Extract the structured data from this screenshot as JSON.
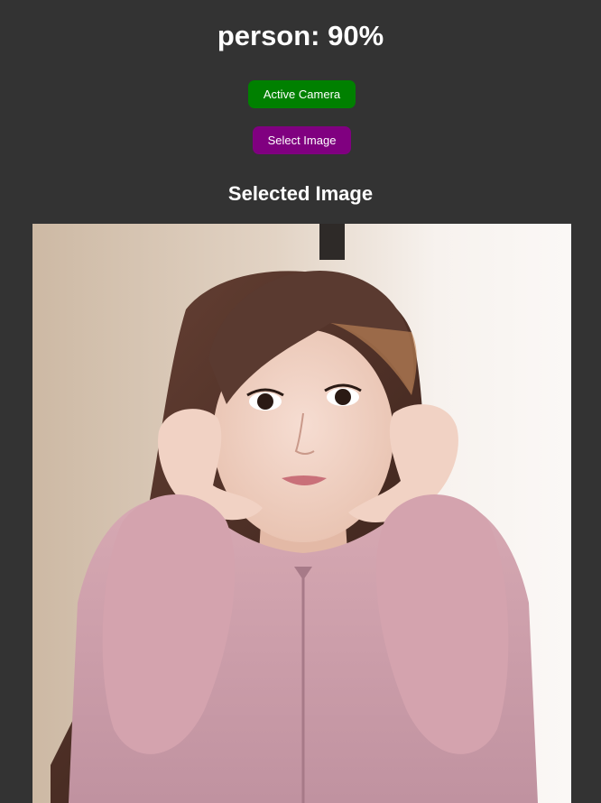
{
  "detection": {
    "label": "person: 90%"
  },
  "controls": {
    "camera_button_label": "Active Camera",
    "camera_button_color": "#008000",
    "select_button_label": "Select Image",
    "select_button_color": "#800080"
  },
  "preview": {
    "heading": "Selected Image",
    "image_icon": "photo-of-person"
  },
  "colors": {
    "background": "#333333",
    "text": "#ffffff"
  }
}
